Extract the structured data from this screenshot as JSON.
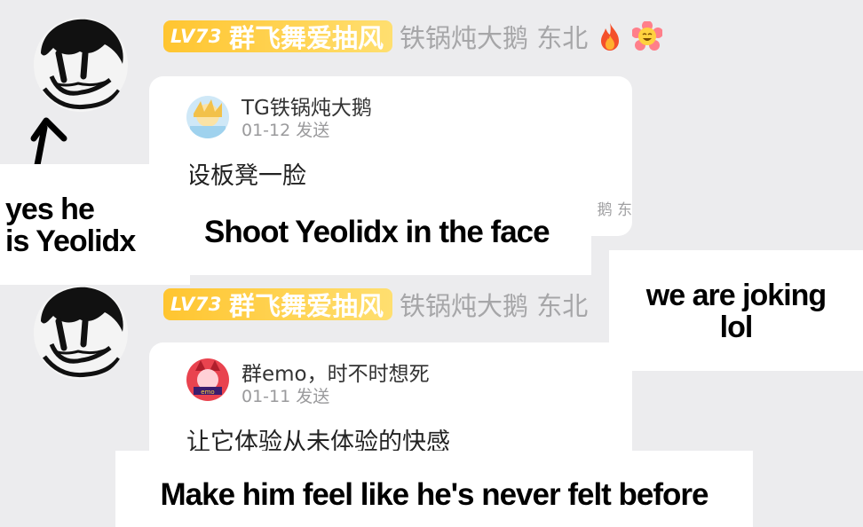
{
  "messages": [
    {
      "level": "LV73",
      "title": "群飞舞爱抽风",
      "nickname": "铁锅炖大鹅 东北",
      "emoji_1": "fire-emoji",
      "emoji_2": "flower-face-emoji",
      "quote": {
        "author": "TG铁锅炖大鹅",
        "date": "01-12 发送",
        "text": "设板凳一脸",
        "tail": "鹅 东"
      }
    },
    {
      "level": "LV73",
      "title": "群飞舞爱抽风",
      "nickname": "铁锅炖大鹅 东北",
      "quote": {
        "author": "群emo，时不时想死",
        "date": "01-11 发送",
        "text": "让它体验从未体验的快感"
      }
    }
  ],
  "captions": {
    "yes_he": "yes he",
    "is_yeolidx": "is Yeolidx",
    "shoot": "Shoot Yeolidx in the face",
    "joking_1": "we are joking",
    "joking_2": "lol",
    "make_him": "Make him feel like he's never felt before"
  },
  "colors": {
    "background": "#ececee",
    "badge_gradient_start": "#ffc530",
    "badge_gradient_end": "#ffdf70",
    "nickname_gray": "#a6a6a8",
    "card": "#ffffff"
  }
}
